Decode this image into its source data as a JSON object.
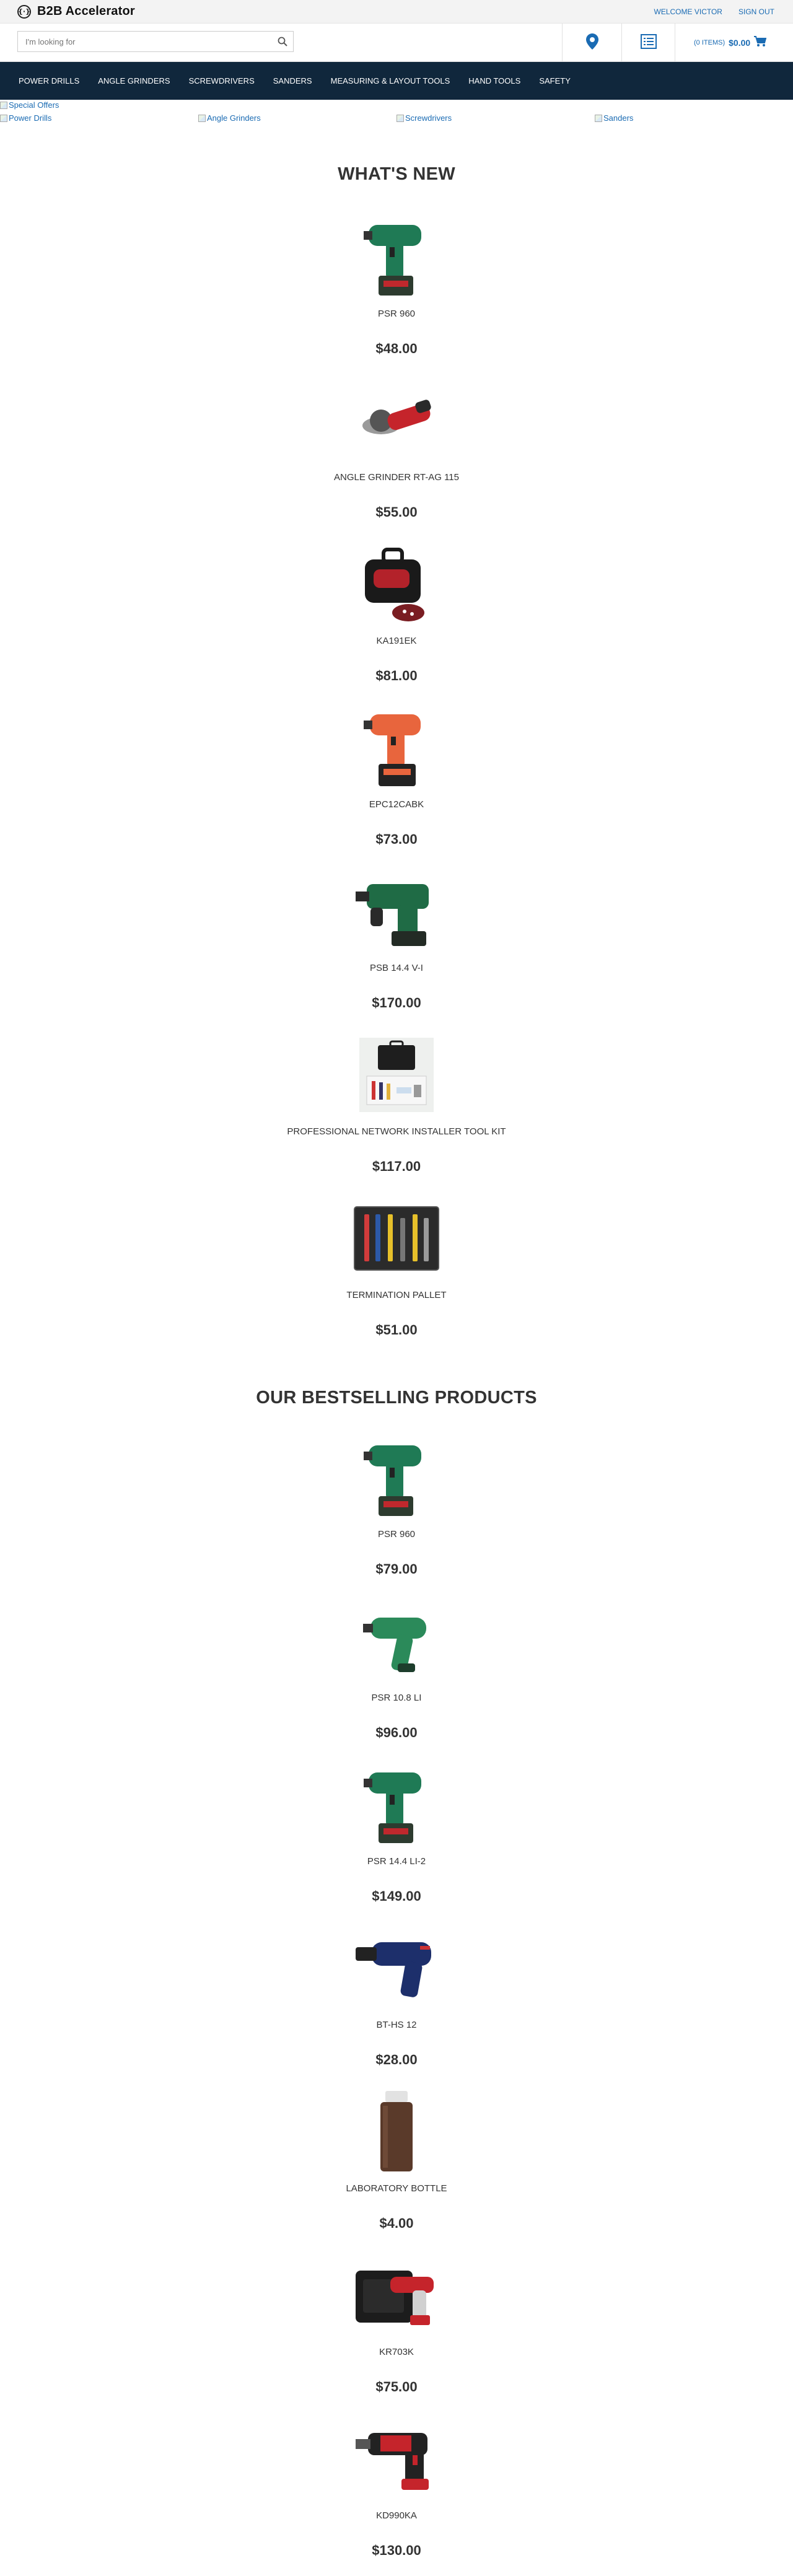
{
  "header": {
    "brand": "B2B Accelerator",
    "logo_glyph": "{·}",
    "welcome": "WELCOME VICTOR",
    "sign_out": "SIGN OUT",
    "search_placeholder": "I'm looking for",
    "cart_items": "(0 ITEMS)",
    "cart_total": "$0.00",
    "accent_color": "#1a6bb3",
    "nav_color": "#10273c"
  },
  "nav": {
    "items": [
      "POWER DRILLS",
      "ANGLE GRINDERS",
      "SCREWDRIVERS",
      "SANDERS",
      "MEASURING & LAYOUT TOOLS",
      "HAND TOOLS",
      "SAFETY"
    ]
  },
  "banners": {
    "special_offers": "Special Offers",
    "categories": [
      "Power Drills",
      "Angle Grinders",
      "Screwdrivers",
      "Sanders"
    ]
  },
  "whats_new": {
    "title": "WHAT'S NEW",
    "products": [
      {
        "name": "PSR 960",
        "price": "$48.00",
        "icon": "green-cordless-drill"
      },
      {
        "name": "ANGLE GRINDER RT-AG 115",
        "price": "$55.00",
        "icon": "red-angle-grinder"
      },
      {
        "name": "KA191EK",
        "price": "$81.00",
        "icon": "black-sander-case"
      },
      {
        "name": "EPC12CABK",
        "price": "$73.00",
        "icon": "orange-cordless-drill"
      },
      {
        "name": "PSB 14.4 V-I",
        "price": "$170.00",
        "icon": "green-hammer-drill"
      },
      {
        "name": "PROFESSIONAL NETWORK INSTALLER TOOL KIT",
        "price": "$117.00",
        "icon": "tool-kit-case"
      },
      {
        "name": "TERMINATION PALLET",
        "price": "$51.00",
        "icon": "tool-pallet"
      }
    ]
  },
  "bestselling": {
    "title": "OUR BESTSELLING PRODUCTS",
    "products": [
      {
        "name": "PSR 960",
        "price": "$79.00",
        "icon": "green-cordless-drill"
      },
      {
        "name": "PSR 10.8 LI",
        "price": "$96.00",
        "icon": "green-compact-drill"
      },
      {
        "name": "PSR 14.4 LI-2",
        "price": "$149.00",
        "icon": "green-cordless-drill"
      },
      {
        "name": "BT-HS 12",
        "price": "$28.00",
        "icon": "blue-heat-gun"
      },
      {
        "name": "LABORATORY BOTTLE",
        "price": "$4.00",
        "icon": "brown-bottle"
      },
      {
        "name": "KR703K",
        "price": "$75.00",
        "icon": "drill-in-case"
      },
      {
        "name": "KD990KA",
        "price": "$130.00",
        "icon": "red-rotary-hammer"
      }
    ]
  }
}
